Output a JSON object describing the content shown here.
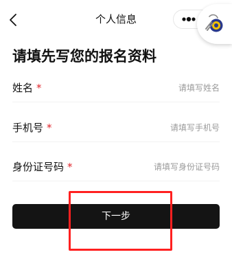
{
  "nav": {
    "title": "个人信息",
    "back_icon": "chevron-left-icon",
    "more_icon": "more-dots-icon"
  },
  "form": {
    "heading": "请填先写您的报名资料",
    "required_mark": "*",
    "required_color": "#e0252b",
    "fields": [
      {
        "label": "姓名",
        "placeholder": "请填写姓名",
        "value": ""
      },
      {
        "label": "手机号",
        "placeholder": "请填写手机号",
        "value": ""
      },
      {
        "label": "身份证号码",
        "placeholder": "请填写身份证号码",
        "value": ""
      }
    ]
  },
  "next_button": {
    "label": "下一步",
    "background": "#141414"
  },
  "annotation": {
    "color": "#ff2020"
  }
}
